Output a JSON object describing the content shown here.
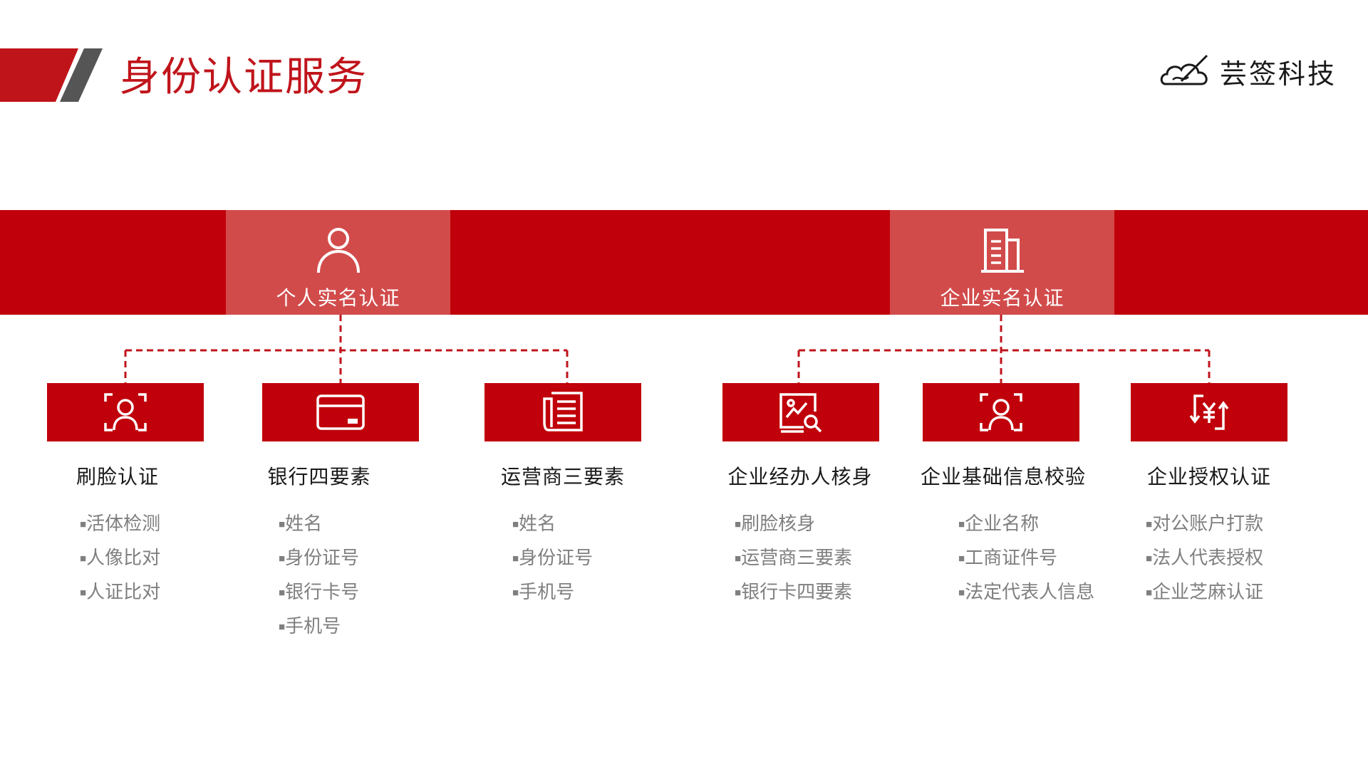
{
  "header": {
    "title": "身份认证服务",
    "logo_text": "芸签科技",
    "colors": {
      "accent": "#c0141b",
      "stripe_dark": "#555555",
      "band": "#c0000a",
      "band_highlight": "#d24b4b"
    }
  },
  "categories": [
    {
      "label": "个人实名认证",
      "icon": "user-icon"
    },
    {
      "label": "企业实名认证",
      "icon": "building-icon"
    }
  ],
  "methods": [
    {
      "title": "刷脸认证",
      "icon": "face-scan-icon",
      "items": [
        "活体检测",
        "人像比对",
        "人证比对"
      ]
    },
    {
      "title": "银行四要素",
      "icon": "bank-card-icon",
      "items": [
        "姓名",
        "身份证号",
        "银行卡号",
        "手机号"
      ]
    },
    {
      "title": "运营商三要素",
      "icon": "document-icon",
      "items": [
        "姓名",
        "身份证号",
        "手机号"
      ]
    },
    {
      "title": "企业经办人核身",
      "icon": "id-card-search-icon",
      "items": [
        "刷脸核身",
        "运营商三要素",
        "银行卡四要素"
      ]
    },
    {
      "title": "企业基础信息校验",
      "icon": "face-scan-icon",
      "items": [
        "企业名称",
        "工商证件号",
        "法定代表人信息"
      ]
    },
    {
      "title": "企业授权认证",
      "icon": "yuan-exchange-icon",
      "items": [
        "对公账户打款",
        "法人代表授权",
        "企业芝麻认证"
      ]
    }
  ]
}
